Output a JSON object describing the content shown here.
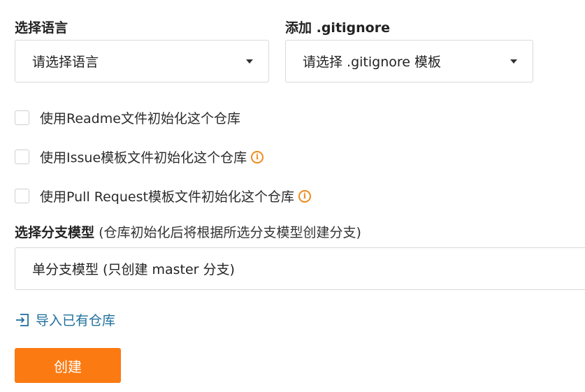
{
  "language": {
    "label": "选择语言",
    "value": "请选择语言"
  },
  "gitignore": {
    "label": "添加 .gitignore",
    "value": "请选择 .gitignore 模板"
  },
  "checkboxes": [
    {
      "label": "使用Readme文件初始化这个仓库",
      "checked": false,
      "has_info": false
    },
    {
      "label": "使用Issue模板文件初始化这个仓库",
      "checked": false,
      "has_info": true
    },
    {
      "label": "使用Pull Request模板文件初始化这个仓库",
      "checked": false,
      "has_info": true
    }
  ],
  "branch_model": {
    "label": "选择分支模型",
    "hint": "(仓库初始化后将根据所选分支模型创建分支)",
    "value": "单分支模型 (只创建 master 分支)"
  },
  "import_link": {
    "label": "导入已有仓库",
    "icon": "import-icon"
  },
  "create_button": {
    "label": "创建"
  },
  "colors": {
    "accent": "#fb7a12",
    "link": "#1f6f9c",
    "info": "#f08a1c"
  }
}
